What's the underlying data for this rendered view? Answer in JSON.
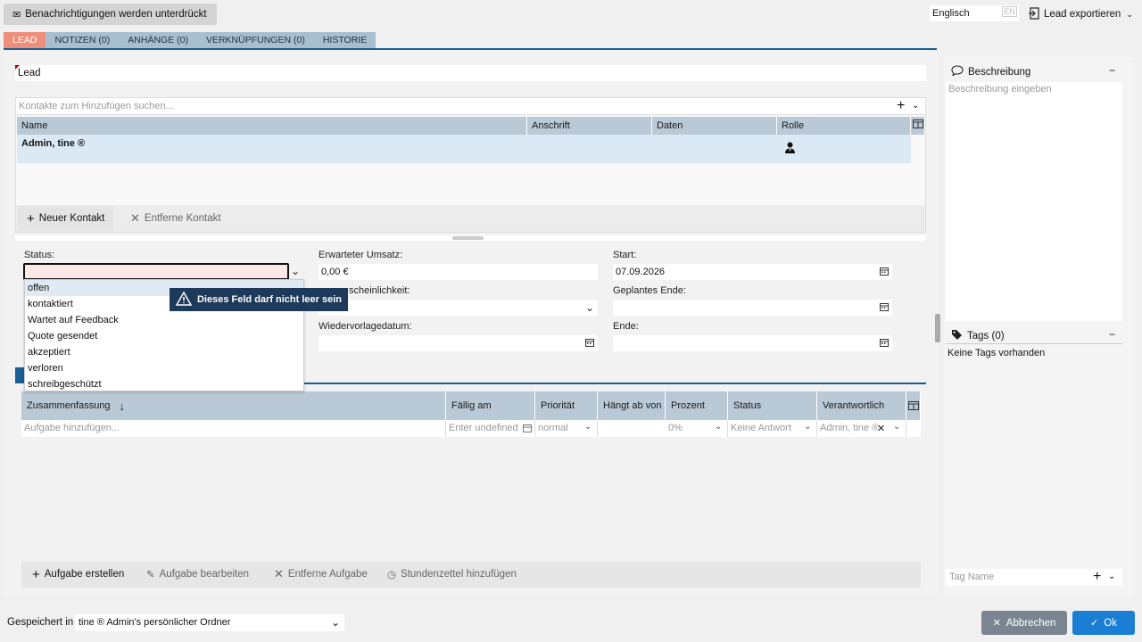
{
  "topbar": {
    "notifications_label": "Benachrichtigungen werden unterdrückt",
    "language_value": "Englisch",
    "language_code": "EN",
    "export_label": "Lead exportieren"
  },
  "tabs": [
    {
      "label": "LEAD",
      "active": true
    },
    {
      "label": "NOTIZEN (0)",
      "active": false
    },
    {
      "label": "ANHÄNGE (0)",
      "active": false
    },
    {
      "label": "VERKNÜPFUNGEN (0)",
      "active": false
    },
    {
      "label": "HISTORIE",
      "active": false
    }
  ],
  "lead": {
    "title_value": "Lead"
  },
  "contacts": {
    "search_placeholder": "Kontakte zum Hinzufügen suchen...",
    "columns": [
      "Name",
      "Anschrift",
      "Daten",
      "Rolle"
    ],
    "rows": [
      {
        "name": "Admin, tine ®",
        "anschrift": "",
        "daten": "",
        "rolle_icon": "user-role-icon"
      }
    ],
    "new_contact_label": "Neuer Kontakt",
    "remove_contact_label": "Entferne Kontakt"
  },
  "form": {
    "status_label": "Status:",
    "status_value": "",
    "expected_revenue_label": "Erwarteter Umsatz:",
    "expected_revenue_value": "0,00 €",
    "probability_label": "Wahrscheinlichkeit:",
    "probability_visible_label": "scheinlichkeit:",
    "probability_value": "",
    "followup_label": "Wiedervorlagedatum:",
    "followup_value": "",
    "start_label": "Start:",
    "start_value": "07.09.2026",
    "planned_end_label": "Geplantes Ende:",
    "planned_end_value": "",
    "end_label": "Ende:",
    "end_value": ""
  },
  "status_options": [
    "offen",
    "kontaktiert",
    "Wartet auf Feedback",
    "Quote gesendet",
    "akzeptiert",
    "verloren",
    "schreibgeschützt"
  ],
  "validation_tooltip": "Dieses Feld darf nicht leer sein",
  "tasks": {
    "columns": [
      "Zusammenfassung",
      "Fällig am",
      "Priorität",
      "Hängt ab von",
      "Prozent",
      "Status",
      "Verantwortlich"
    ],
    "add_placeholder": "Aufgabe hinzufügen...",
    "due_placeholder": "Enter undefined",
    "priority_value": "normal",
    "percent_value": "0%",
    "status_value": "Keine Antwort",
    "responsible_value": "Admin, tine ®",
    "create_label": "Aufgabe erstellen",
    "edit_label": "Aufgabe bearbeiten",
    "remove_label": "Entferne Aufgabe",
    "timesheet_label": "Stundenzettel hinzufügen"
  },
  "sidebar": {
    "description_title": "Beschreibung",
    "description_placeholder": "Beschreibung eingeben",
    "tags_title": "Tags (0)",
    "no_tags": "Keine Tags vorhanden",
    "tag_placeholder": "Tag Name"
  },
  "footer": {
    "saved_in_label": "Gespeichert in",
    "folder_value": "tine ® Admin's persönlicher Ordner",
    "cancel_label": "Abbrechen",
    "ok_label": "Ok"
  },
  "colors": {
    "accent": "#1a5e93",
    "tab_active": "#ef8f7a",
    "grid_header": "#b9c9d6",
    "ok_button": "#1a7fd4",
    "cancel_button": "#7a8591"
  }
}
